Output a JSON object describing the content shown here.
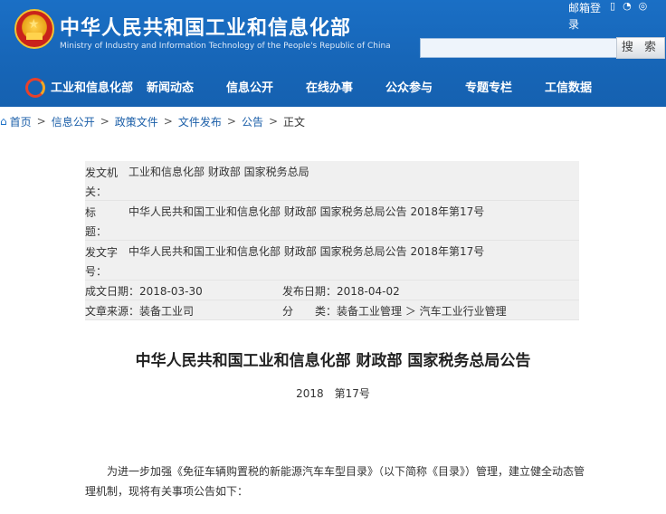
{
  "header": {
    "site_title": "中华人民共和国工业和信息化部",
    "site_subtitle": "Ministry of Industry and Information Technology of the People's Republic of China",
    "mail_login": "邮箱登录",
    "search_placeholder": "",
    "search_button": "搜 索",
    "colors": {
      "header_blue": "#1766b8"
    }
  },
  "nav": {
    "items": [
      "工业和信息化部",
      "新闻动态",
      "信息公开",
      "在线办事",
      "公众参与",
      "专题专栏",
      "工信数据"
    ]
  },
  "breadcrumb": {
    "items": [
      "首页",
      "信息公开",
      "政策文件",
      "文件发布",
      "公告"
    ],
    "current": "正文"
  },
  "meta": {
    "issuer_label": "发文机关：",
    "issuer_value": "工业和信息化部 财政部 国家税务总局",
    "title_label": "标　　题：",
    "title_value": "中华人民共和国工业和信息化部 财政部 国家税务总局公告 2018年第17号",
    "docno_label": "发文字号：",
    "docno_value": "中华人民共和国工业和信息化部 财政部 国家税务总局公告 2018年第17号",
    "created": "成文日期：2018-03-30",
    "published": "发布日期：2018-04-02",
    "source": "文章来源：装备工业司",
    "category": "分　　类：装备工业管理 ＞ 汽车工业行业管理"
  },
  "article": {
    "title": "中华人民共和国工业和信息化部 财政部 国家税务总局公告",
    "number": "2018　第17号",
    "paragraph": "为进一步加强《免征车辆购置税的新能源汽车车型目录》（以下简称《目录》）管理，建立健全动态管理机制，现将有关事项公告如下："
  }
}
